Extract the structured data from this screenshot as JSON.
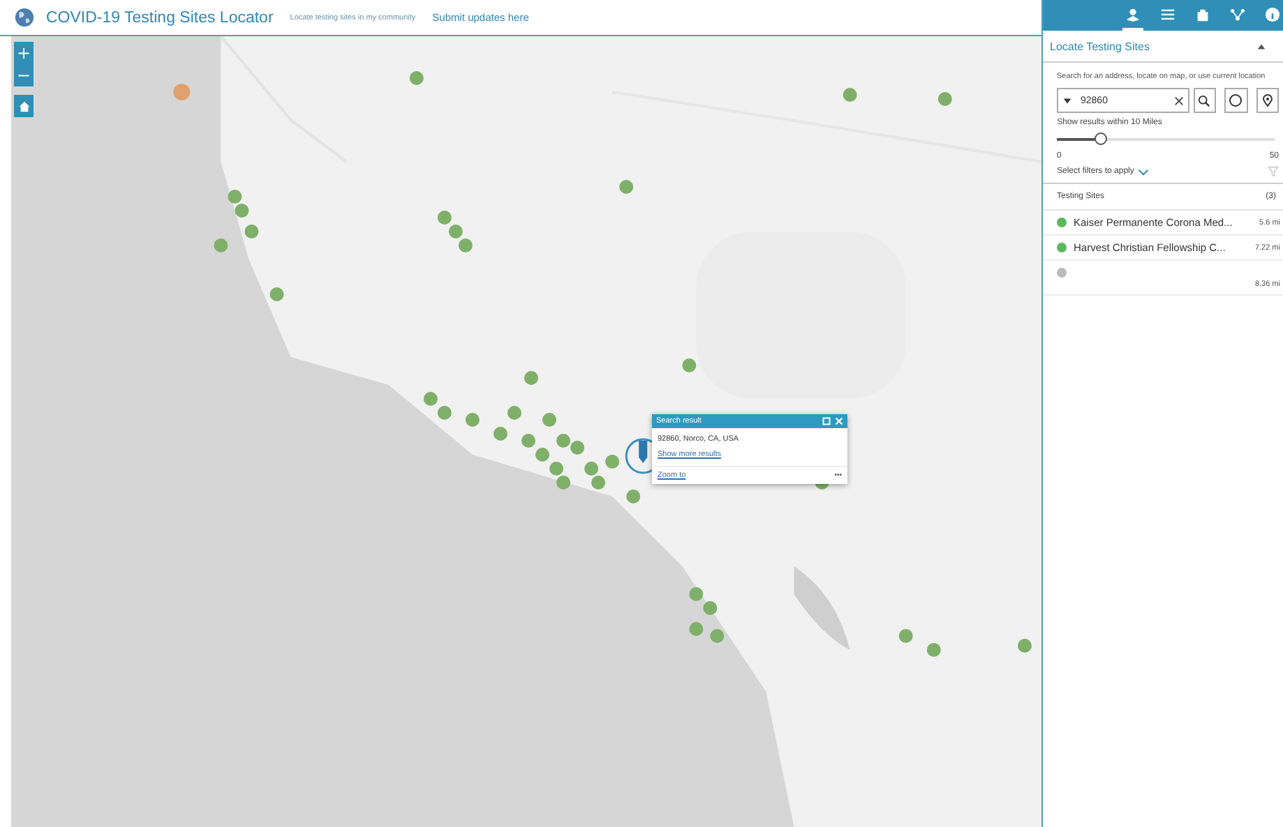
{
  "header": {
    "title": "COVID-19 Testing Sites Locator",
    "links": [
      "Locate testing sites in my community",
      "Submit updates here"
    ]
  },
  "map": {
    "zoom_controls": [
      "+",
      "−"
    ]
  },
  "popup": {
    "title": "Search result",
    "address": "92860, Norco, CA, USA",
    "link": "Show more results",
    "action": "Zoom to",
    "more": "•••"
  },
  "panel": {
    "toolbar": [
      {
        "kind": "locate",
        "selected": true
      },
      {
        "kind": "list",
        "selected": false
      },
      {
        "kind": "bag",
        "selected": false
      },
      {
        "kind": "share",
        "selected": false
      },
      {
        "kind": "info",
        "selected": false
      }
    ],
    "title": "Locate Testing Sites",
    "instructions": "Search for an address, locate on map, or use current location",
    "search": {
      "value": "92860"
    },
    "radius": {
      "label": "Show results within 10 Miles",
      "level": 0.2,
      "min": "0",
      "max": "50"
    },
    "filters": "Select filters to apply",
    "results": {
      "heading": "Testing Sites",
      "count": "(3)",
      "items": [
        {
          "name": "Kaiser Permanente Corona Med...",
          "distance": "5.6 mi",
          "color": "#5cb85c"
        },
        {
          "name": "Harvest Christian Fellowship C...",
          "distance": "7.22 mi",
          "color": "#5cb85c"
        },
        {
          "distance": "8.36 mi",
          "color": "#bbbbbb"
        }
      ]
    }
  }
}
